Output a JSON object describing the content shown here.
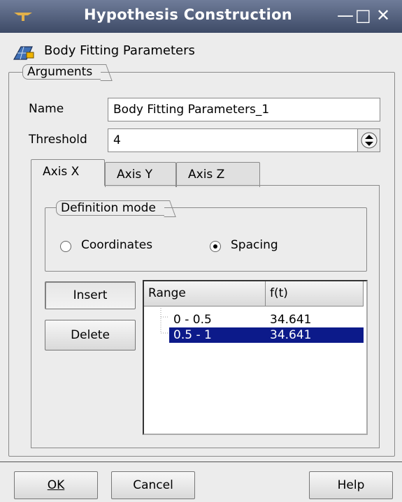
{
  "window": {
    "title": "Hypothesis Construction",
    "minimize_glyph": "—",
    "maximize_glyph": "□",
    "close_glyph": "✕"
  },
  "header": {
    "label": "Body Fitting Parameters",
    "icon": "mesh-hypothesis-icon"
  },
  "arguments": {
    "group_label": "Arguments",
    "name_label": "Name",
    "name_value": "Body Fitting Parameters_1",
    "threshold_label": "Threshold",
    "threshold_value": "4"
  },
  "tabs": [
    {
      "label": "Axis X",
      "active": true
    },
    {
      "label": "Axis Y",
      "active": false
    },
    {
      "label": "Axis Z",
      "active": false
    }
  ],
  "definition_mode": {
    "group_label": "Definition mode",
    "options": [
      {
        "label": "Coordinates",
        "selected": false
      },
      {
        "label": "Spacing",
        "selected": true
      }
    ]
  },
  "actions": {
    "insert": "Insert",
    "delete": "Delete"
  },
  "table": {
    "columns": [
      "Range",
      "f(t)"
    ],
    "rows": [
      {
        "range": "0 - 0.5",
        "ft": "34.641",
        "selected": false
      },
      {
        "range": "0.5 - 1",
        "ft": "34.641",
        "selected": true
      }
    ]
  },
  "footer": {
    "ok": "OK",
    "cancel": "Cancel",
    "help": "Help"
  },
  "colors": {
    "selection": "#0c1a8a",
    "titlebar": "#4a5775"
  }
}
